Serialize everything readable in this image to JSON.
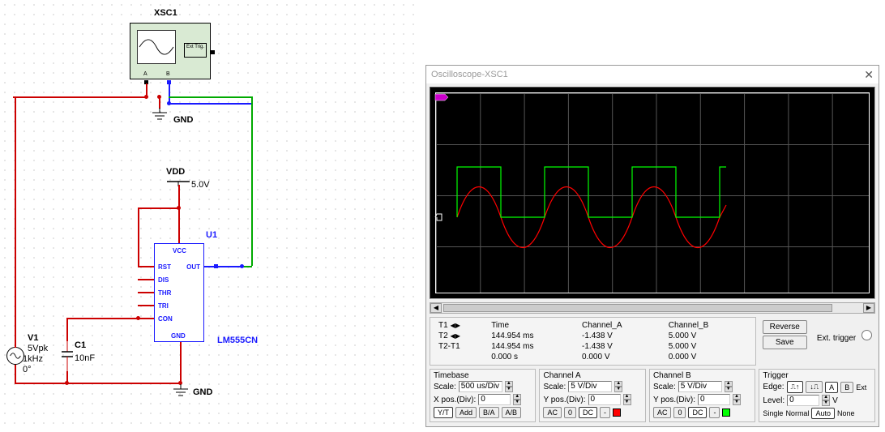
{
  "schematic": {
    "xsc1": {
      "label": "XSC1",
      "ext_trig": "Ext Trig.",
      "ch_a": "A",
      "ch_b": "B"
    },
    "gnd1": "GND",
    "vdd": {
      "label": "VDD",
      "value": "5.0V"
    },
    "u1": {
      "refdes": "U1",
      "part": "LM555CN",
      "pins": {
        "vcc": "VCC",
        "rst": "RST",
        "dis": "DIS",
        "thr": "THR",
        "tri": "TRI",
        "con": "CON",
        "gnd": "GND",
        "out": "OUT"
      }
    },
    "v1": {
      "refdes": "V1",
      "amp": "5Vpk",
      "freq": "1kHz",
      "phase": "0°"
    },
    "c1": {
      "refdes": "C1",
      "value": "10nF"
    },
    "gnd2": "GND"
  },
  "dialog": {
    "title": "Oscilloscope-XSC1",
    "close": "✕",
    "cursors": {
      "t1": "T1",
      "t2": "T2",
      "diff": "T2-T1",
      "arrows": "◀ ▶",
      "headers": {
        "time": "Time",
        "cha": "Channel_A",
        "chb": "Channel_B"
      },
      "r1": {
        "time": "144.954 ms",
        "cha": "-1.438 V",
        "chb": "5.000 V"
      },
      "r2": {
        "time": "144.954 ms",
        "cha": "-1.438 V",
        "chb": "5.000 V"
      },
      "r3": {
        "time": "0.000 s",
        "cha": "0.000 V",
        "chb": "0.000 V"
      }
    },
    "buttons": {
      "reverse": "Reverse",
      "save": "Save"
    },
    "ext_trigger": "Ext. trigger",
    "timebase": {
      "title": "Timebase",
      "scale_label": "Scale:",
      "scale": "500 us/Div",
      "xpos_label": "X pos.(Div):",
      "xpos": "0",
      "btns": {
        "yt": "Y/T",
        "add": "Add",
        "ba": "B/A",
        "ab": "A/B"
      }
    },
    "chA": {
      "title": "Channel A",
      "scale_label": "Scale:",
      "scale": "5  V/Div",
      "ypos_label": "Y pos.(Div):",
      "ypos": "0",
      "btns": {
        "ac": "AC",
        "zero": "0",
        "dc": "DC",
        "dash": "-"
      },
      "color": "#f00"
    },
    "chB": {
      "title": "Channel B",
      "scale_label": "Scale:",
      "scale": "5  V/Div",
      "ypos_label": "Y pos.(Div):",
      "ypos": "0",
      "btns": {
        "ac": "AC",
        "zero": "0",
        "dc": "DC",
        "dash": "-"
      },
      "color": "#0f0"
    },
    "trigger": {
      "title": "Trigger",
      "edge_label": "Edge:",
      "edge_btns": {
        "rise": "⎍↑",
        "fall": "↓⎍",
        "a": "A",
        "b": "B",
        "ext": "Ext"
      },
      "level_label": "Level:",
      "level": "0",
      "level_unit": "V",
      "modes": {
        "single": "Single",
        "normal": "Normal",
        "auto": "Auto",
        "none": "None"
      }
    }
  },
  "chart_data": {
    "type": "line",
    "x_unit": "ms",
    "y_unit": "V",
    "timebase_per_div": 0.5,
    "y_per_div": 5,
    "divs_x": 10,
    "divs_y": 4,
    "series": [
      {
        "name": "Channel_A",
        "color": "#f00",
        "waveform": "sine",
        "amplitude_V": 5,
        "frequency_kHz": 1,
        "offset_V": 0,
        "start_ms": 0.25,
        "end_ms": 3.3
      },
      {
        "name": "Channel_B",
        "color": "#0f0",
        "waveform": "square",
        "low_V": 0,
        "high_V": 5,
        "frequency_kHz": 1,
        "duty": 0.5,
        "start_ms": 0.25,
        "end_ms": 3.3
      }
    ]
  }
}
